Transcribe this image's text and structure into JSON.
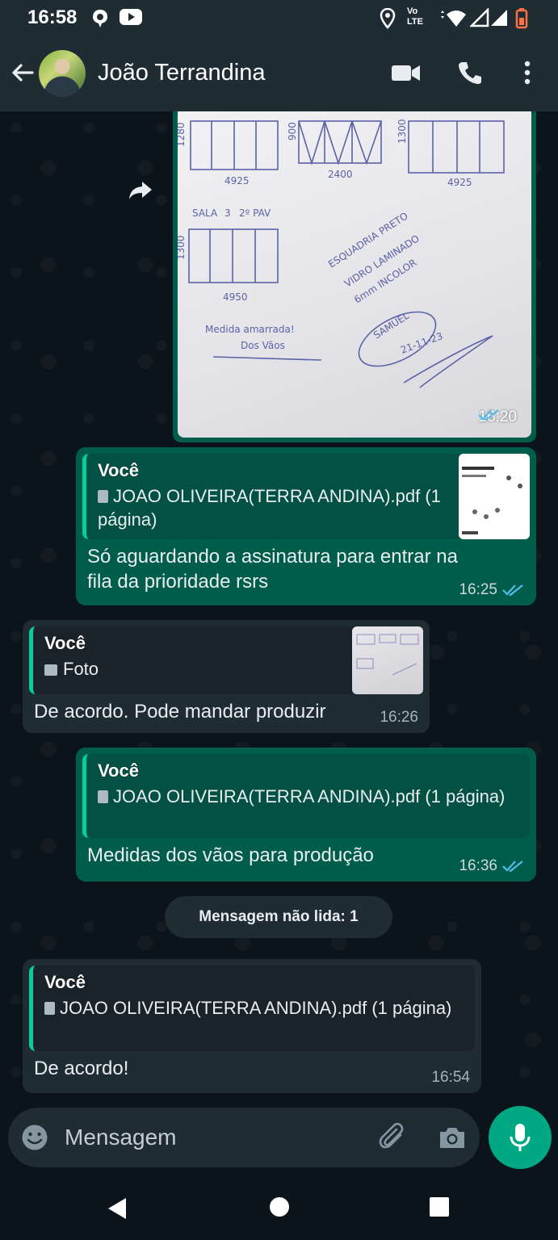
{
  "status_bar": {
    "time": "16:58",
    "network_label_top": "Vo",
    "network_label_bottom": "LTE"
  },
  "header": {
    "contact_name": "João Terrandina"
  },
  "messages": {
    "image_message": {
      "time": "16:20",
      "sketch_labels": [
        "1280",
        "4925",
        "900",
        "2400",
        "1300",
        "4925",
        "SALA",
        "3",
        "2º PAV",
        "1300",
        "4950",
        "ESQUADRIA PRETO",
        "VIDRO LAMINADO",
        "6mm INCOLOR",
        "SAMUEL",
        "21-11-23",
        "Medida amarrada!",
        "Dos Vãos"
      ]
    },
    "msg1": {
      "quote_author": "Você",
      "quote_text": "JOAO OLIVEIRA(TERRA ANDINA).pdf (1 página)",
      "text": "Só aguardando a assinatura para entrar na fila da prioridade rsrs",
      "time": "16:25"
    },
    "msg2": {
      "quote_author": "Você",
      "quote_text": "Foto",
      "text": "De acordo. Pode mandar produzir",
      "time": "16:26"
    },
    "msg3": {
      "quote_author": "Você",
      "quote_text": "JOAO OLIVEIRA(TERRA ANDINA).pdf (1 página)",
      "text": "Medidas dos vãos para produção",
      "time": "16:36"
    },
    "unread_label": "Mensagem não lida: 1",
    "msg4": {
      "quote_author": "Você",
      "quote_text": "JOAO OLIVEIRA(TERRA ANDINA).pdf (1 página)",
      "text": "De acordo!",
      "time": "16:54"
    }
  },
  "composer": {
    "placeholder": "Mensagem"
  },
  "colors": {
    "outgoing_bubble": "#005c4b",
    "incoming_bubble": "#1f2c34",
    "accent": "#00a884",
    "read_ticks": "#53bdeb"
  }
}
